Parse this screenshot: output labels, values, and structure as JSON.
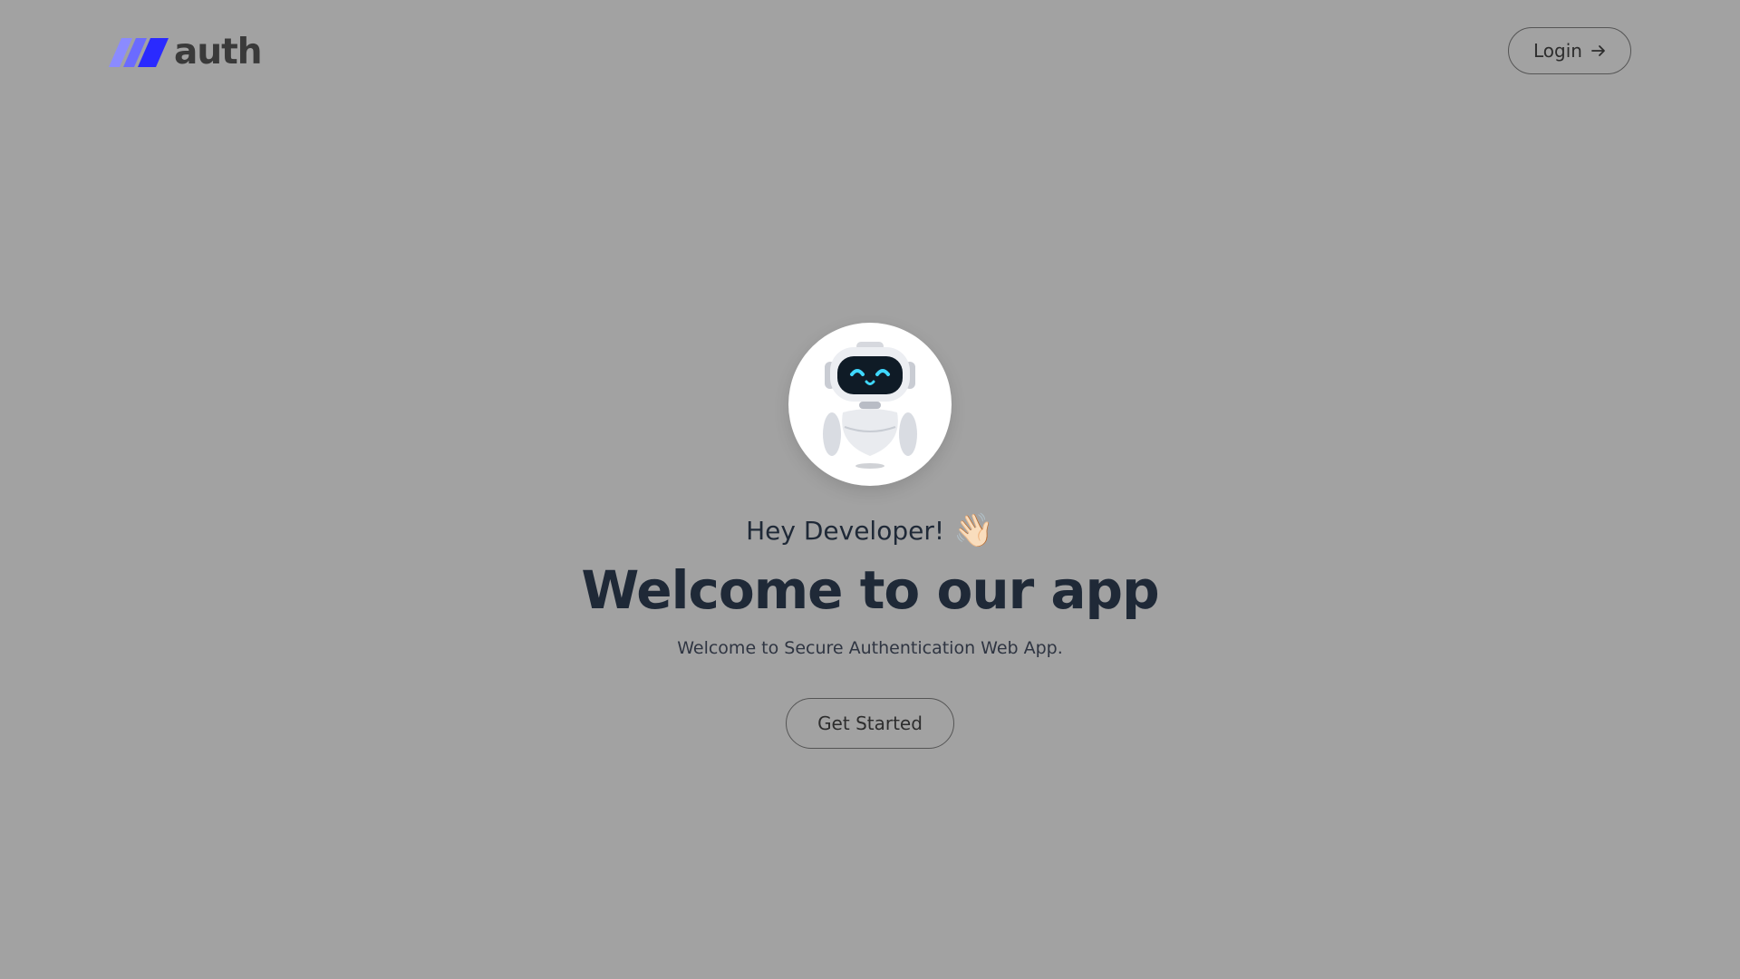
{
  "header": {
    "logo_text": "auth",
    "logo_colors": [
      "#8b8bff",
      "#6b6bff",
      "#2a2aff"
    ],
    "login_label": "Login",
    "login_icon": "arrow-right-icon"
  },
  "hero": {
    "avatar_icon": "robot-icon",
    "greeting": "Hey Developer!",
    "greeting_emoji": "👋🏻",
    "title": "Welcome to our app",
    "subtitle": "Welcome to Secure Authentication Web App.",
    "cta_label": "Get Started"
  },
  "colors": {
    "background": "#a2a2a2",
    "text": "#1f2937"
  }
}
